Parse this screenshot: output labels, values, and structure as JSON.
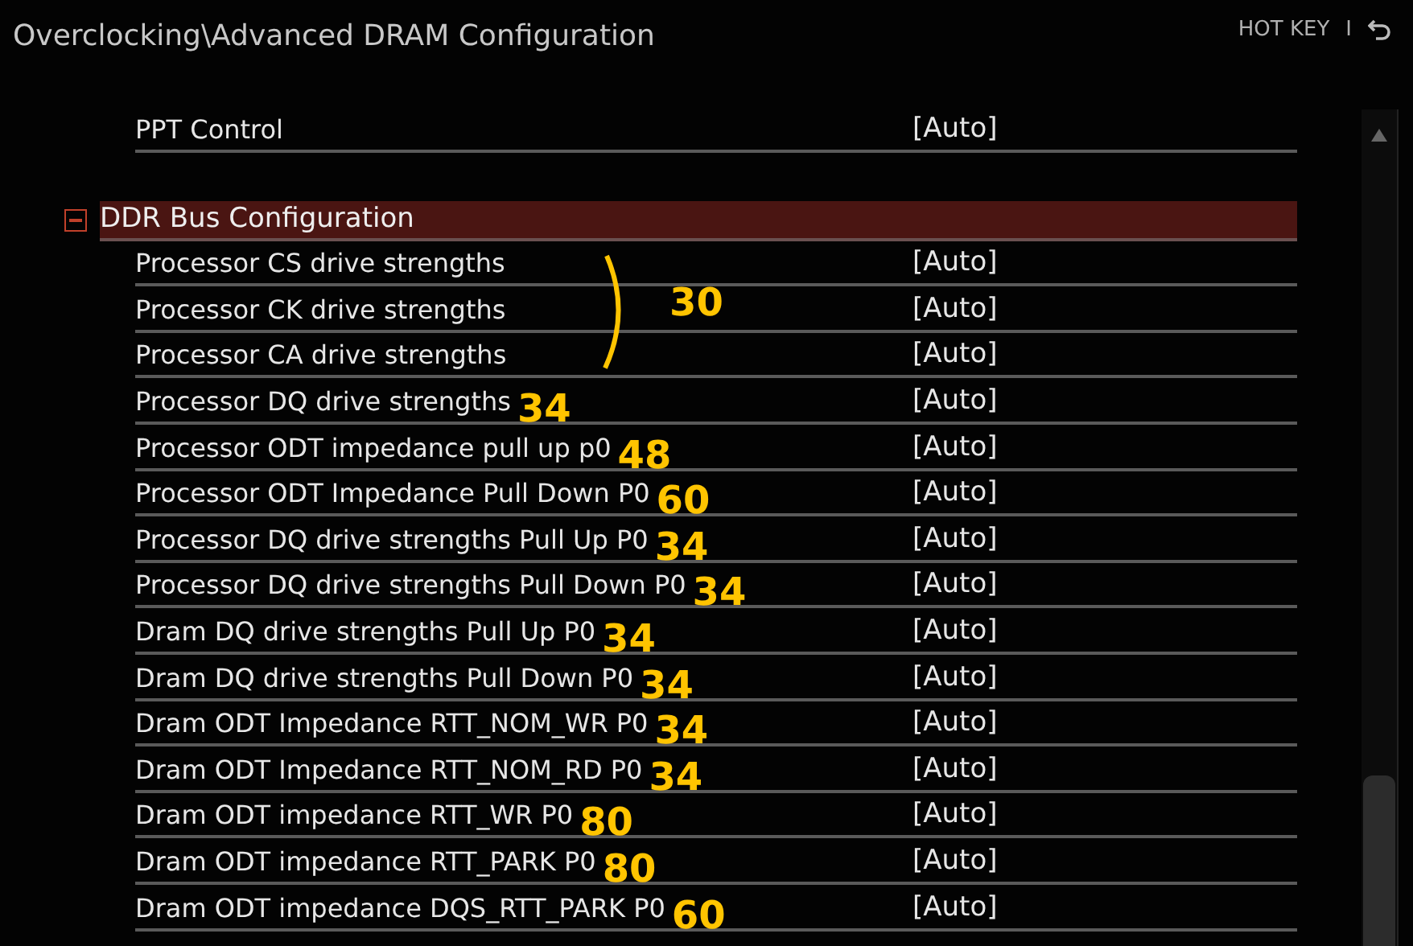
{
  "header": {
    "path": "Overclocking\\Advanced DRAM Configuration",
    "hotkey": "HOT KEY",
    "separator": "I"
  },
  "top_items": [
    {
      "label": "PPT Control",
      "value": "[Auto]"
    }
  ],
  "section": {
    "title": "DDR Bus Configuration",
    "expanded": true,
    "selected": true,
    "bracket_note": "30"
  },
  "items": [
    {
      "label": "Processor CS drive strengths",
      "value": "[Auto]",
      "bracketed": true
    },
    {
      "label": "Processor CK drive strengths",
      "value": "[Auto]",
      "bracketed": true
    },
    {
      "label": "Processor CA drive strengths",
      "value": "[Auto]",
      "bracketed": true
    },
    {
      "label": "Processor DQ drive strengths",
      "value": "[Auto]",
      "note": "34"
    },
    {
      "label": "Processor ODT impedance pull up p0",
      "value": "[Auto]",
      "note": "48"
    },
    {
      "label": "Processor ODT Impedance Pull Down P0",
      "value": "[Auto]",
      "note": "60"
    },
    {
      "label": "Processor DQ drive strengths Pull Up P0",
      "value": "[Auto]",
      "note": "34"
    },
    {
      "label": "Processor DQ drive strengths Pull Down P0",
      "value": "[Auto]",
      "note": "34"
    },
    {
      "label": "Dram DQ drive strengths Pull Up P0",
      "value": "[Auto]",
      "note": "34"
    },
    {
      "label": "Dram DQ drive strengths Pull Down P0",
      "value": "[Auto]",
      "note": "34"
    },
    {
      "label": "Dram ODT Impedance RTT_NOM_WR P0",
      "value": "[Auto]",
      "note": "34"
    },
    {
      "label": "Dram ODT Impedance RTT_NOM_RD P0",
      "value": "[Auto]",
      "note": "34"
    },
    {
      "label": "Dram ODT impedance RTT_WR P0",
      "value": "[Auto]",
      "note": "80"
    },
    {
      "label": "Dram ODT impedance RTT_PARK P0",
      "value": "[Auto]",
      "note": "80"
    },
    {
      "label": "Dram ODT impedance DQS_RTT_PARK P0",
      "value": "[Auto]",
      "note": "60"
    }
  ]
}
